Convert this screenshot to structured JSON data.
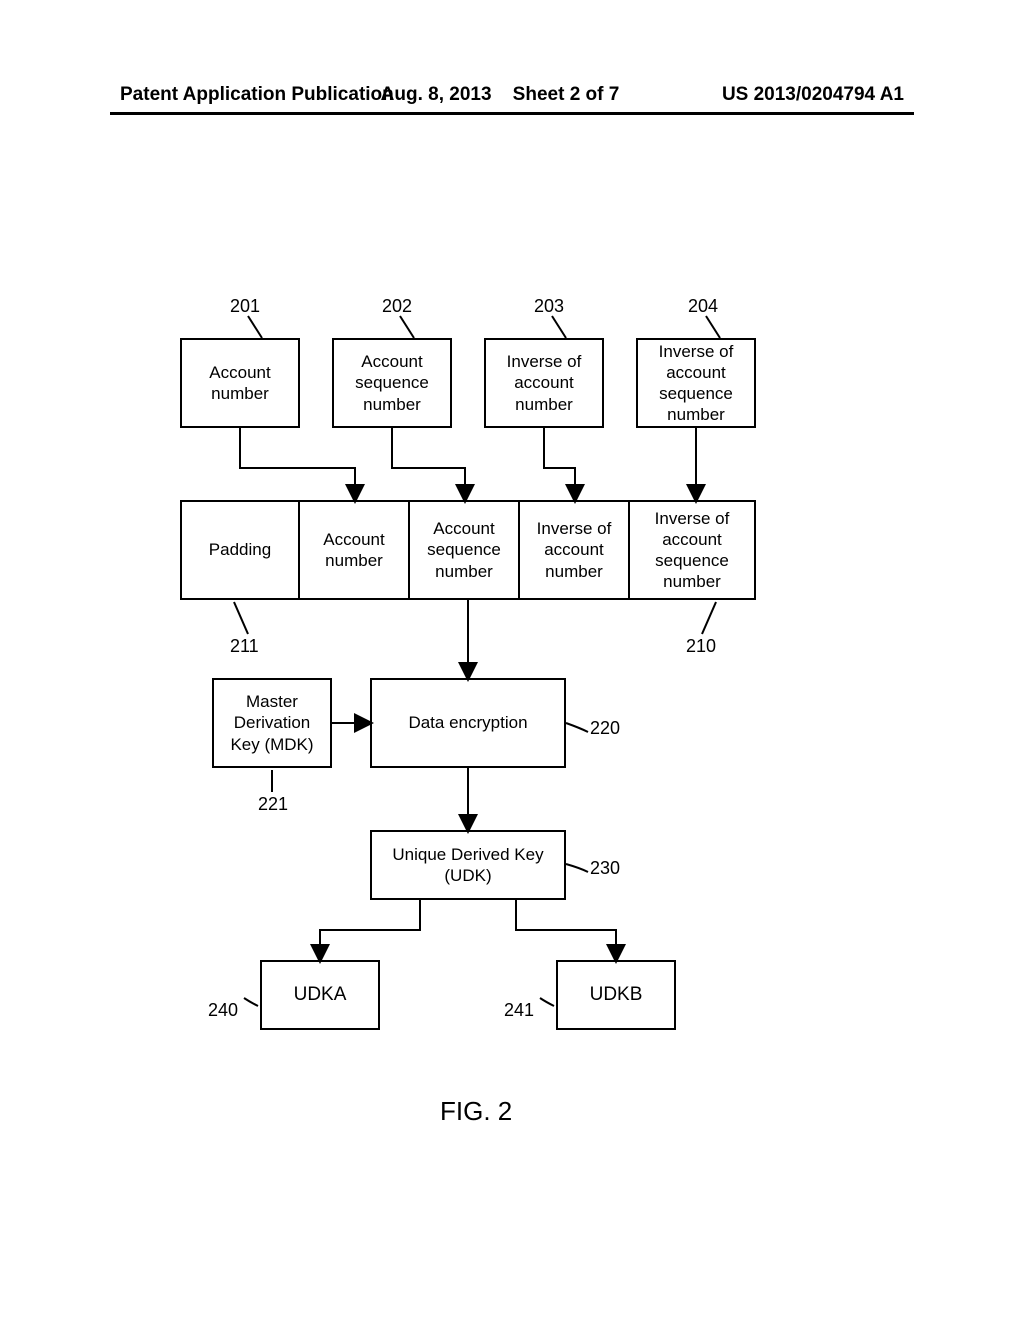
{
  "header": {
    "left": "Patent Application Publication",
    "mid_date": "Aug. 8, 2013",
    "mid_sheet": "Sheet 2 of 7",
    "right": "US 2013/0204794 A1"
  },
  "refs": {
    "r201": "201",
    "r202": "202",
    "r203": "203",
    "r204": "204",
    "r210": "210",
    "r211": "211",
    "r220": "220",
    "r221": "221",
    "r230": "230",
    "r240": "240",
    "r241": "241"
  },
  "top": {
    "b1": "Account number",
    "b2": "Account sequence number",
    "b3": "Inverse of account number",
    "b4": "Inverse of account sequence number"
  },
  "row2": {
    "c1": "Padding",
    "c2": "Account number",
    "c3": "Account sequence number",
    "c4": "Inverse of account number",
    "c5": "Inverse of account sequence number"
  },
  "mdk": "Master Derivation Key (MDK)",
  "enc": "Data encryption",
  "udk": "Unique Derived Key (UDK)",
  "udka": "UDKA",
  "udkb": "UDKB",
  "figure": "FIG. 2"
}
